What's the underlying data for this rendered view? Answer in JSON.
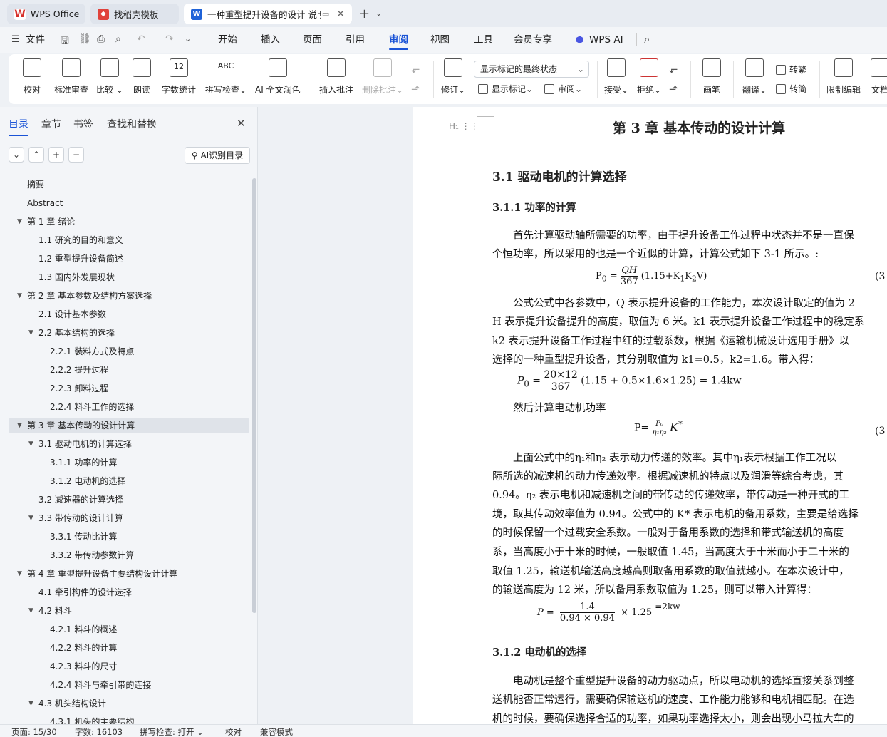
{
  "tabs": [
    {
      "label": "WPS Office"
    },
    {
      "label": "找稻壳模板"
    },
    {
      "label": "一种重型提升设备的设计 说明"
    }
  ],
  "menu": {
    "file": "文件",
    "items": [
      "开始",
      "插入",
      "页面",
      "引用",
      "审阅",
      "视图",
      "工具",
      "会员专享",
      "WPS AI"
    ]
  },
  "ribbon": {
    "proofread": "校对",
    "standard_review": "标准审查",
    "compare": "比较",
    "read_aloud": "朗读",
    "word_count": "字数统计",
    "spell_check": "拼写检查",
    "ai_polish": "AI 全文润色",
    "insert_comment": "插入批注",
    "delete_comment": "删除批注",
    "revise": "修订",
    "markup_select": "显示标记的最终状态",
    "show_markup": "显示标记",
    "review_pane": "审阅",
    "accept": "接受",
    "reject": "拒绝",
    "pen": "画笔",
    "translate": "翻译",
    "to_traditional": "转繁",
    "to_simplified": "转简",
    "restrict_edit": "限制编辑",
    "doc": "文档",
    "wc_icon_text": "12",
    "spell_icon_text": "ABC"
  },
  "sidebar": {
    "tabs": [
      "目录",
      "章节",
      "书签",
      "查找和替换"
    ],
    "ai_toc": "AI识别目录",
    "toc": [
      {
        "label": "摘要",
        "level": 0
      },
      {
        "label": "Abstract",
        "level": 0
      },
      {
        "label": "第 1 章  绪论",
        "level": 0,
        "arrow": true
      },
      {
        "label": "1.1 研究的目的和意义",
        "level": 1
      },
      {
        "label": "1.2 重型提升设备简述",
        "level": 1
      },
      {
        "label": "1.3 国内外发展现状",
        "level": 1
      },
      {
        "label": "第 2 章  基本参数及结构方案选择",
        "level": 0,
        "arrow": true
      },
      {
        "label": "2.1 设计基本参数",
        "level": 1
      },
      {
        "label": "2.2 基本结构的选择",
        "level": 1,
        "arrow": true
      },
      {
        "label": "2.2.1 装料方式及特点",
        "level": 2
      },
      {
        "label": "2.2.2 提升过程",
        "level": 2
      },
      {
        "label": "2.2.3 卸料过程",
        "level": 2
      },
      {
        "label": "2.2.4 料斗工作的选择",
        "level": 2
      },
      {
        "label": "第 3 章  基本传动的设计计算",
        "level": 0,
        "arrow": true,
        "selected": true
      },
      {
        "label": "3.1 驱动电机的计算选择",
        "level": 1,
        "arrow": true
      },
      {
        "label": "3.1.1 功率的计算",
        "level": 2
      },
      {
        "label": "3.1.2 电动机的选择",
        "level": 2
      },
      {
        "label": "3.2 减速器的计算选择",
        "level": 1
      },
      {
        "label": "3.3 带传动的设计计算",
        "level": 1,
        "arrow": true
      },
      {
        "label": "3.3.1 传动比计算",
        "level": 2
      },
      {
        "label": "3.3.2 带传动参数计算",
        "level": 2
      },
      {
        "label": "第 4 章  重型提升设备主要结构设计计算",
        "level": 0,
        "arrow": true
      },
      {
        "label": "4.1 牵引构件的设计选择",
        "level": 1
      },
      {
        "label": "4.2 料斗",
        "level": 1,
        "arrow": true
      },
      {
        "label": "4.2.1 料斗的概述",
        "level": 2
      },
      {
        "label": "4.2.2 料斗的计算",
        "level": 2
      },
      {
        "label": "4.2.3 料斗的尺寸",
        "level": 2
      },
      {
        "label": "4.2.4 料斗与牵引带的连接",
        "level": 2
      },
      {
        "label": "4.3 机头结构设计",
        "level": 1,
        "arrow": true
      },
      {
        "label": "4.3.1 机头的主要结构",
        "level": 2
      }
    ]
  },
  "doc": {
    "chapter_title": "第 3 章  基本传动的设计计算",
    "h31": "3.1 驱动电机的计算选择",
    "h311": "3.1.1 功率的计算",
    "lines": [
      "　　首先计算驱动轴所需要的功率，由于提升设备工作过程中状态并不是一直保",
      "个恒功率，所以采用的也是一个近似的计算，计算公式如下 3-1 所示。:",
      "　　公式公式中各参数中，Q 表示提升设备的工作能力，本次设计取定的值为 2",
      "H 表示提升设备提升的高度，取值为 6 米。k1 表示提升设备工作过程中的稳定系",
      "k2 表示提升设备工作过程中红的过载系数，根据《运输机械设计选用手册》以",
      "选择的一种重型提升设备，其分别取值为 k1=0.5，k2=1.6。带入得：",
      "　　然后计算电动机功率",
      "　　上面公式中的η₁和η₂ 表示动力传递的效率。其中η₁表示根据工作工况以",
      "际所选的减速机的动力传递效率。根据减速机的特点以及润滑等综合考虑，其",
      "0.94。η₂ 表示电机和减速机之间的带传动的传递效率，带传动是一种开式的工",
      "境，取其传动效率值为 0.94。公式中的 K* 表示电机的备用系数，主要是给选择",
      "的时候保留一个过载安全系数。一般对于备用系数的选择和带式输送机的高度",
      "系，当高度小于十米的时候，一般取值 1.45，当高度大于十米而小于二十米的",
      "取值 1.25，输送机输送高度越高则取备用系数的取值就越小。在本次设计中，",
      "的输送高度为 12 米，所以备用系数取值为 1.25，则可以带入计算得：",
      "　　电动机是整个重型提升设备的动力驱动点，所以电动机的选择直接关系到整",
      "送机能否正常运行，需要确保输送机的速度、工作能力能够和电机相匹配。在选",
      "机的时候，要确保选择合适的功率，如果功率选择太小，则会出现小马拉大车的"
    ],
    "h312": "3.1.2 电动机的选择",
    "eq1": {
      "lhs": "P",
      "sub0": "0",
      "num": "QH",
      "den": "367",
      "rest": "(1.15+K",
      "k1": "1",
      "k2": "2",
      "tail": "V)",
      "no": "(3"
    },
    "eq2": {
      "text": "P",
      "sub": "0",
      "num": "20×12",
      "den": "367",
      "rest": "(1.15 + 0.5×1.6×1.25) = 1.4kw"
    },
    "eq3": {
      "lhs": "P=",
      "num": "P₀",
      "den": "η₁η₂",
      "k": "K",
      "star": "*",
      "no": "(3"
    },
    "eq4": {
      "lhs": "P  =",
      "num": "1.4",
      "den": "0.94 × 0.94",
      "rest": "× 1.25",
      "res": "=2kw"
    }
  },
  "status": {
    "page": "页面: 15/30",
    "words": "字数: 16103",
    "spell": "拼写检查: 打开 ⌄",
    "proof": "校对",
    "compat": "兼容模式"
  }
}
